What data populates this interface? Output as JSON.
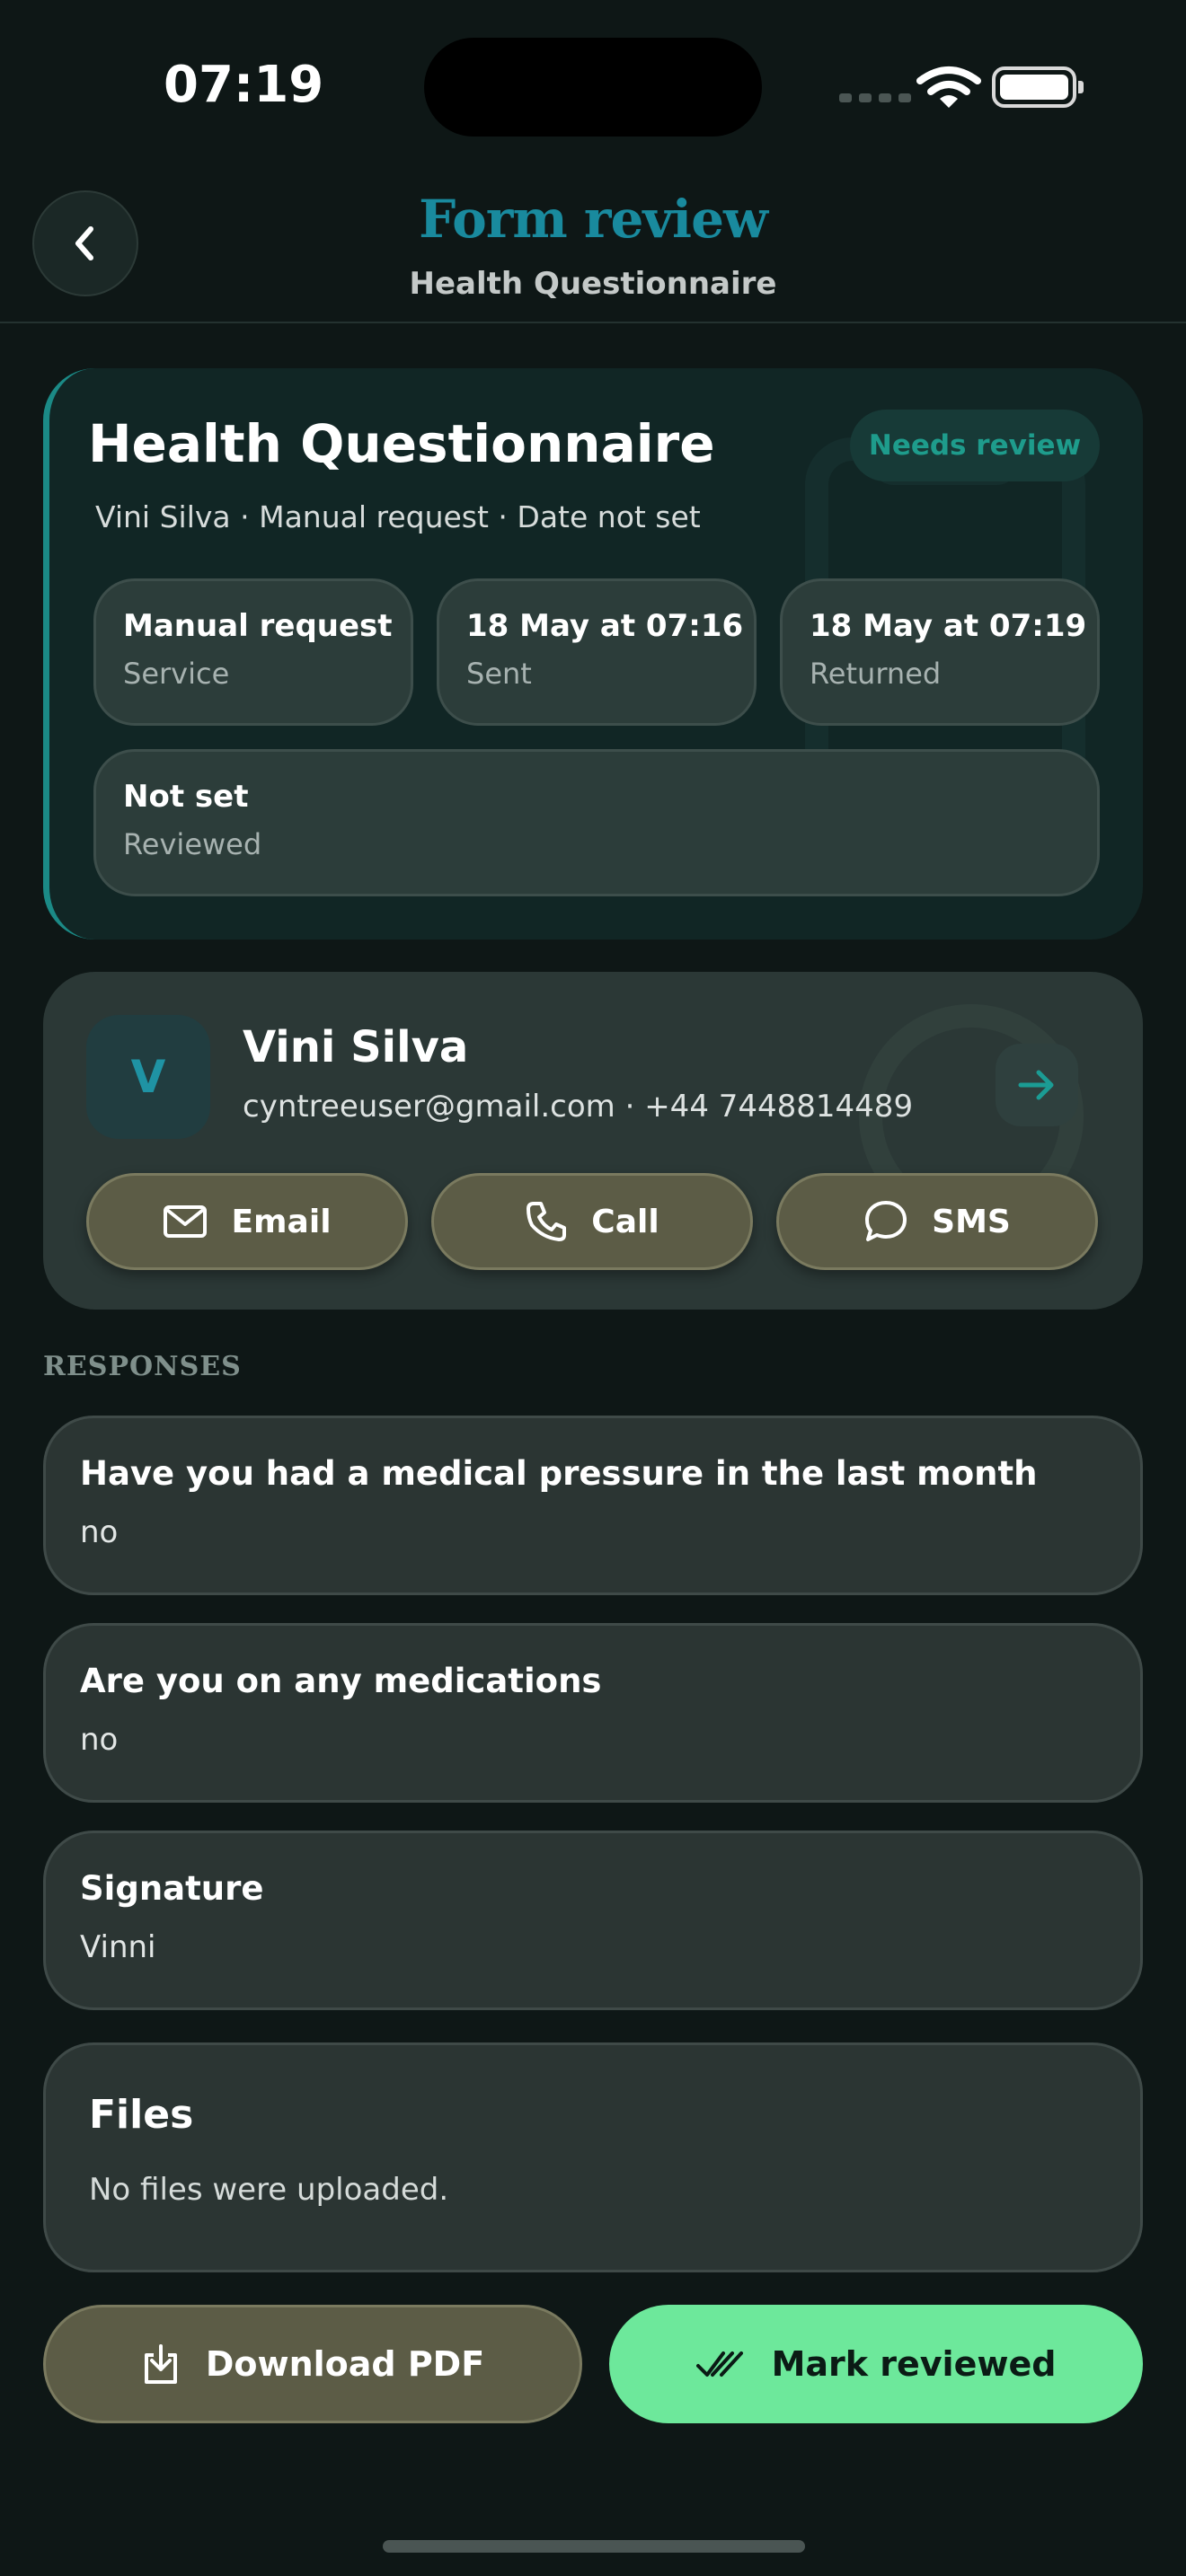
{
  "status_bar": {
    "time": "07:19"
  },
  "header": {
    "title": "Form review",
    "subtitle": "Health Questionnaire",
    "back_icon": "chevron-left-icon"
  },
  "summary": {
    "title": "Health Questionnaire",
    "status": "Needs review",
    "meta": "Vini Silva · Manual request · Date not set",
    "details": [
      {
        "value": "Manual request",
        "label": "Service"
      },
      {
        "value": "18 May at 07:16",
        "label": "Sent"
      },
      {
        "value": "18 May at 07:19",
        "label": "Returned"
      },
      {
        "value": "Not set",
        "label": "Reviewed"
      }
    ],
    "accent_color": "#1b8a86"
  },
  "contact": {
    "initial": "V",
    "name": "Vini Silva",
    "details": "cyntreeuser@gmail.com · +44 7448814489",
    "actions": [
      {
        "label": "Email",
        "icon": "mail-icon"
      },
      {
        "label": "Call",
        "icon": "phone-icon"
      },
      {
        "label": "SMS",
        "icon": "chat-bubble-icon"
      }
    ]
  },
  "responses": {
    "section_label": "RESPONSES",
    "items": [
      {
        "question": "Have you had a medical pressure in the last month",
        "answer": "no"
      },
      {
        "question": "Are you on any medications",
        "answer": "no"
      },
      {
        "question": "Signature",
        "answer": "Vinni"
      }
    ]
  },
  "files": {
    "title": "Files",
    "empty_text": "No files were uploaded."
  },
  "footer": {
    "download_label": "Download PDF",
    "review_label": "Mark reviewed",
    "primary_color": "#6de89b",
    "secondary_color": "#5c5c46"
  }
}
